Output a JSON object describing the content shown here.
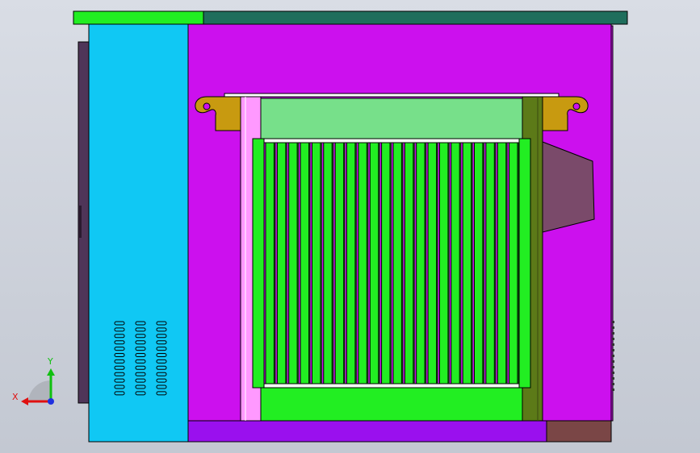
{
  "view": {
    "background_colors": [
      "#d9dde5",
      "#c3c8d2"
    ],
    "projection": "front"
  },
  "model": {
    "name": "",
    "parts": {
      "roof_cap": {
        "colors": [
          "#22ee22",
          "#1f6e5c"
        ]
      },
      "left_side_panel": {
        "color": "#4f3558"
      },
      "left_door": {
        "color": "#10c8f4",
        "vent_rows": 12,
        "vent_columns": 3
      },
      "main_enclosure": {
        "color": "#cc10ee"
      },
      "right_side_panel": {
        "color": "#cc10ee",
        "vent_count": 13
      },
      "base_frame": {
        "color": "#9a10ee"
      },
      "base_block_right": {
        "color": "#7a4646"
      },
      "top_rail": {
        "color": "#ffffff"
      },
      "lifting_lugs": {
        "color": "#c89a10"
      },
      "transformer_top_plate": {
        "color": "#77e08a"
      },
      "transformer_frame_left": {
        "color": "#ff99ff"
      },
      "transformer_frame_right": {
        "color": "#5c7a18"
      },
      "transformer_fins": {
        "color": "#22ee22",
        "count": 22
      },
      "transformer_base": {
        "color": "#22ee22"
      },
      "terminal_box": {
        "color": "#7a4a6a"
      }
    }
  },
  "triad": {
    "x_label": "X",
    "y_label": "Y",
    "x_color": "#e01010",
    "y_color": "#10c010",
    "z_color": "#2030e0"
  }
}
